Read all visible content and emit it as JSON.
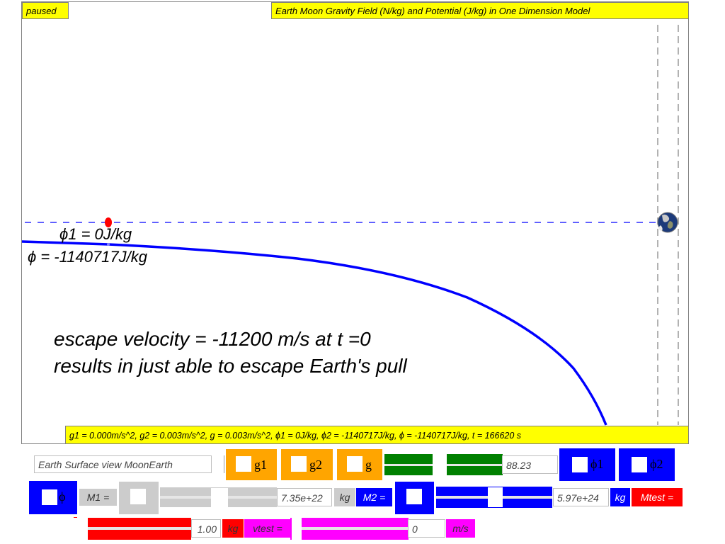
{
  "status_label": "paused",
  "title": "Earth Moon Gravity Field (N/kg) and Potential (J/kg) in One Dimension Model",
  "canvas": {
    "phi1_readout": "ϕ1 = 0J/kg",
    "phi_readout": "ϕ = -1140717J/kg",
    "note_line1": "escape velocity = -11200 m/s at t =0",
    "note_line2": "results in just able to escape Earth's pull"
  },
  "status_bar": "g1 = 0.000m/s^2, g2 = 0.003m/s^2, g = 0.003m/s^2, ϕ1 = 0J/kg, ϕ2 = -1140717J/kg, ϕ = -1140717J/kg, t = 166620 s",
  "controls": {
    "view_select": "Earth Surface view MoonEarth",
    "g1_label": "g1",
    "g2_label": "g2",
    "g_label": "g",
    "slider1_value": "88.23",
    "phi1_label": "ϕ1",
    "phi2_label": "ϕ2",
    "phi_label": "ϕ",
    "m1_label": "M1 =",
    "m1_value": "7.35e+22",
    "m1_unit": "kg",
    "m2_label": "M2 =",
    "m2_value": "5.97e+24",
    "m2_unit": "kg",
    "mtest_label": "Mtest =",
    "mtest_value": "1.00",
    "mtest_unit": "kg",
    "vtest_label": "vtest =",
    "vtest_value": "0",
    "vtest_unit": "m/s"
  },
  "colors": {
    "yellow": "#ffff00",
    "orange": "#ffa500",
    "green": "#008000",
    "blue": "#0000ff",
    "red": "#ff0000",
    "magenta": "#ff00ff",
    "grey": "#cccccc"
  },
  "icons": [
    "earth-icon",
    "test-mass-dot"
  ]
}
